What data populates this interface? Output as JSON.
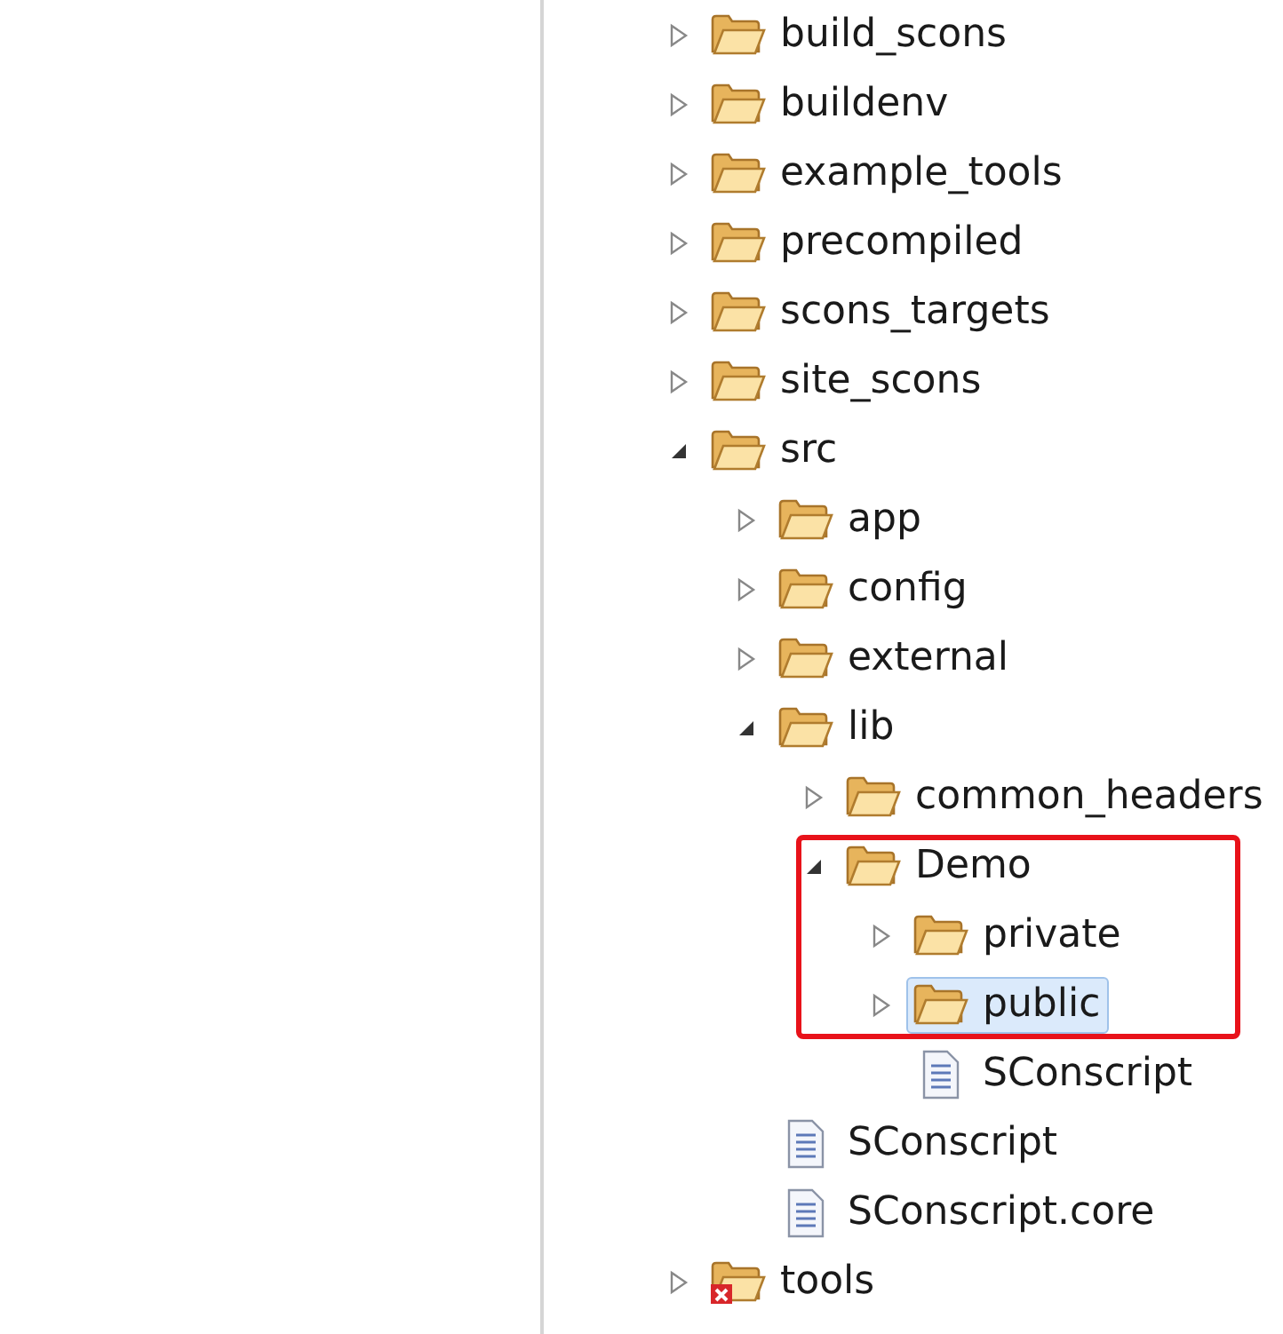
{
  "tree": [
    {
      "label": "build_scons",
      "kind": "folder",
      "expanded": false
    },
    {
      "label": "buildenv",
      "kind": "folder",
      "expanded": false
    },
    {
      "label": "example_tools",
      "kind": "folder",
      "expanded": false
    },
    {
      "label": "precompiled",
      "kind": "folder",
      "expanded": false
    },
    {
      "label": "scons_targets",
      "kind": "folder",
      "expanded": false
    },
    {
      "label": "site_scons",
      "kind": "folder",
      "expanded": false
    },
    {
      "label": "src",
      "kind": "folder",
      "expanded": true,
      "children": [
        {
          "label": "app",
          "kind": "folder",
          "expanded": false
        },
        {
          "label": "config",
          "kind": "folder",
          "expanded": false
        },
        {
          "label": "external",
          "kind": "folder",
          "expanded": false
        },
        {
          "label": "lib",
          "kind": "folder",
          "expanded": true,
          "children": [
            {
              "label": "common_headers",
              "kind": "folder",
              "expanded": false
            },
            {
              "label": "Demo",
              "kind": "folder",
              "expanded": true,
              "highlighted": true,
              "children": [
                {
                  "label": "private",
                  "kind": "folder",
                  "expanded": false,
                  "highlighted": true
                },
                {
                  "label": "public",
                  "kind": "folder",
                  "expanded": false,
                  "highlighted": true,
                  "selected": true
                },
                {
                  "label": "SConscript",
                  "kind": "file"
                }
              ]
            }
          ]
        },
        {
          "label": "SConscript",
          "kind": "file"
        },
        {
          "label": "SConscript.core",
          "kind": "file"
        }
      ]
    },
    {
      "label": "tools",
      "kind": "folder",
      "expanded": false,
      "error": true
    }
  ]
}
